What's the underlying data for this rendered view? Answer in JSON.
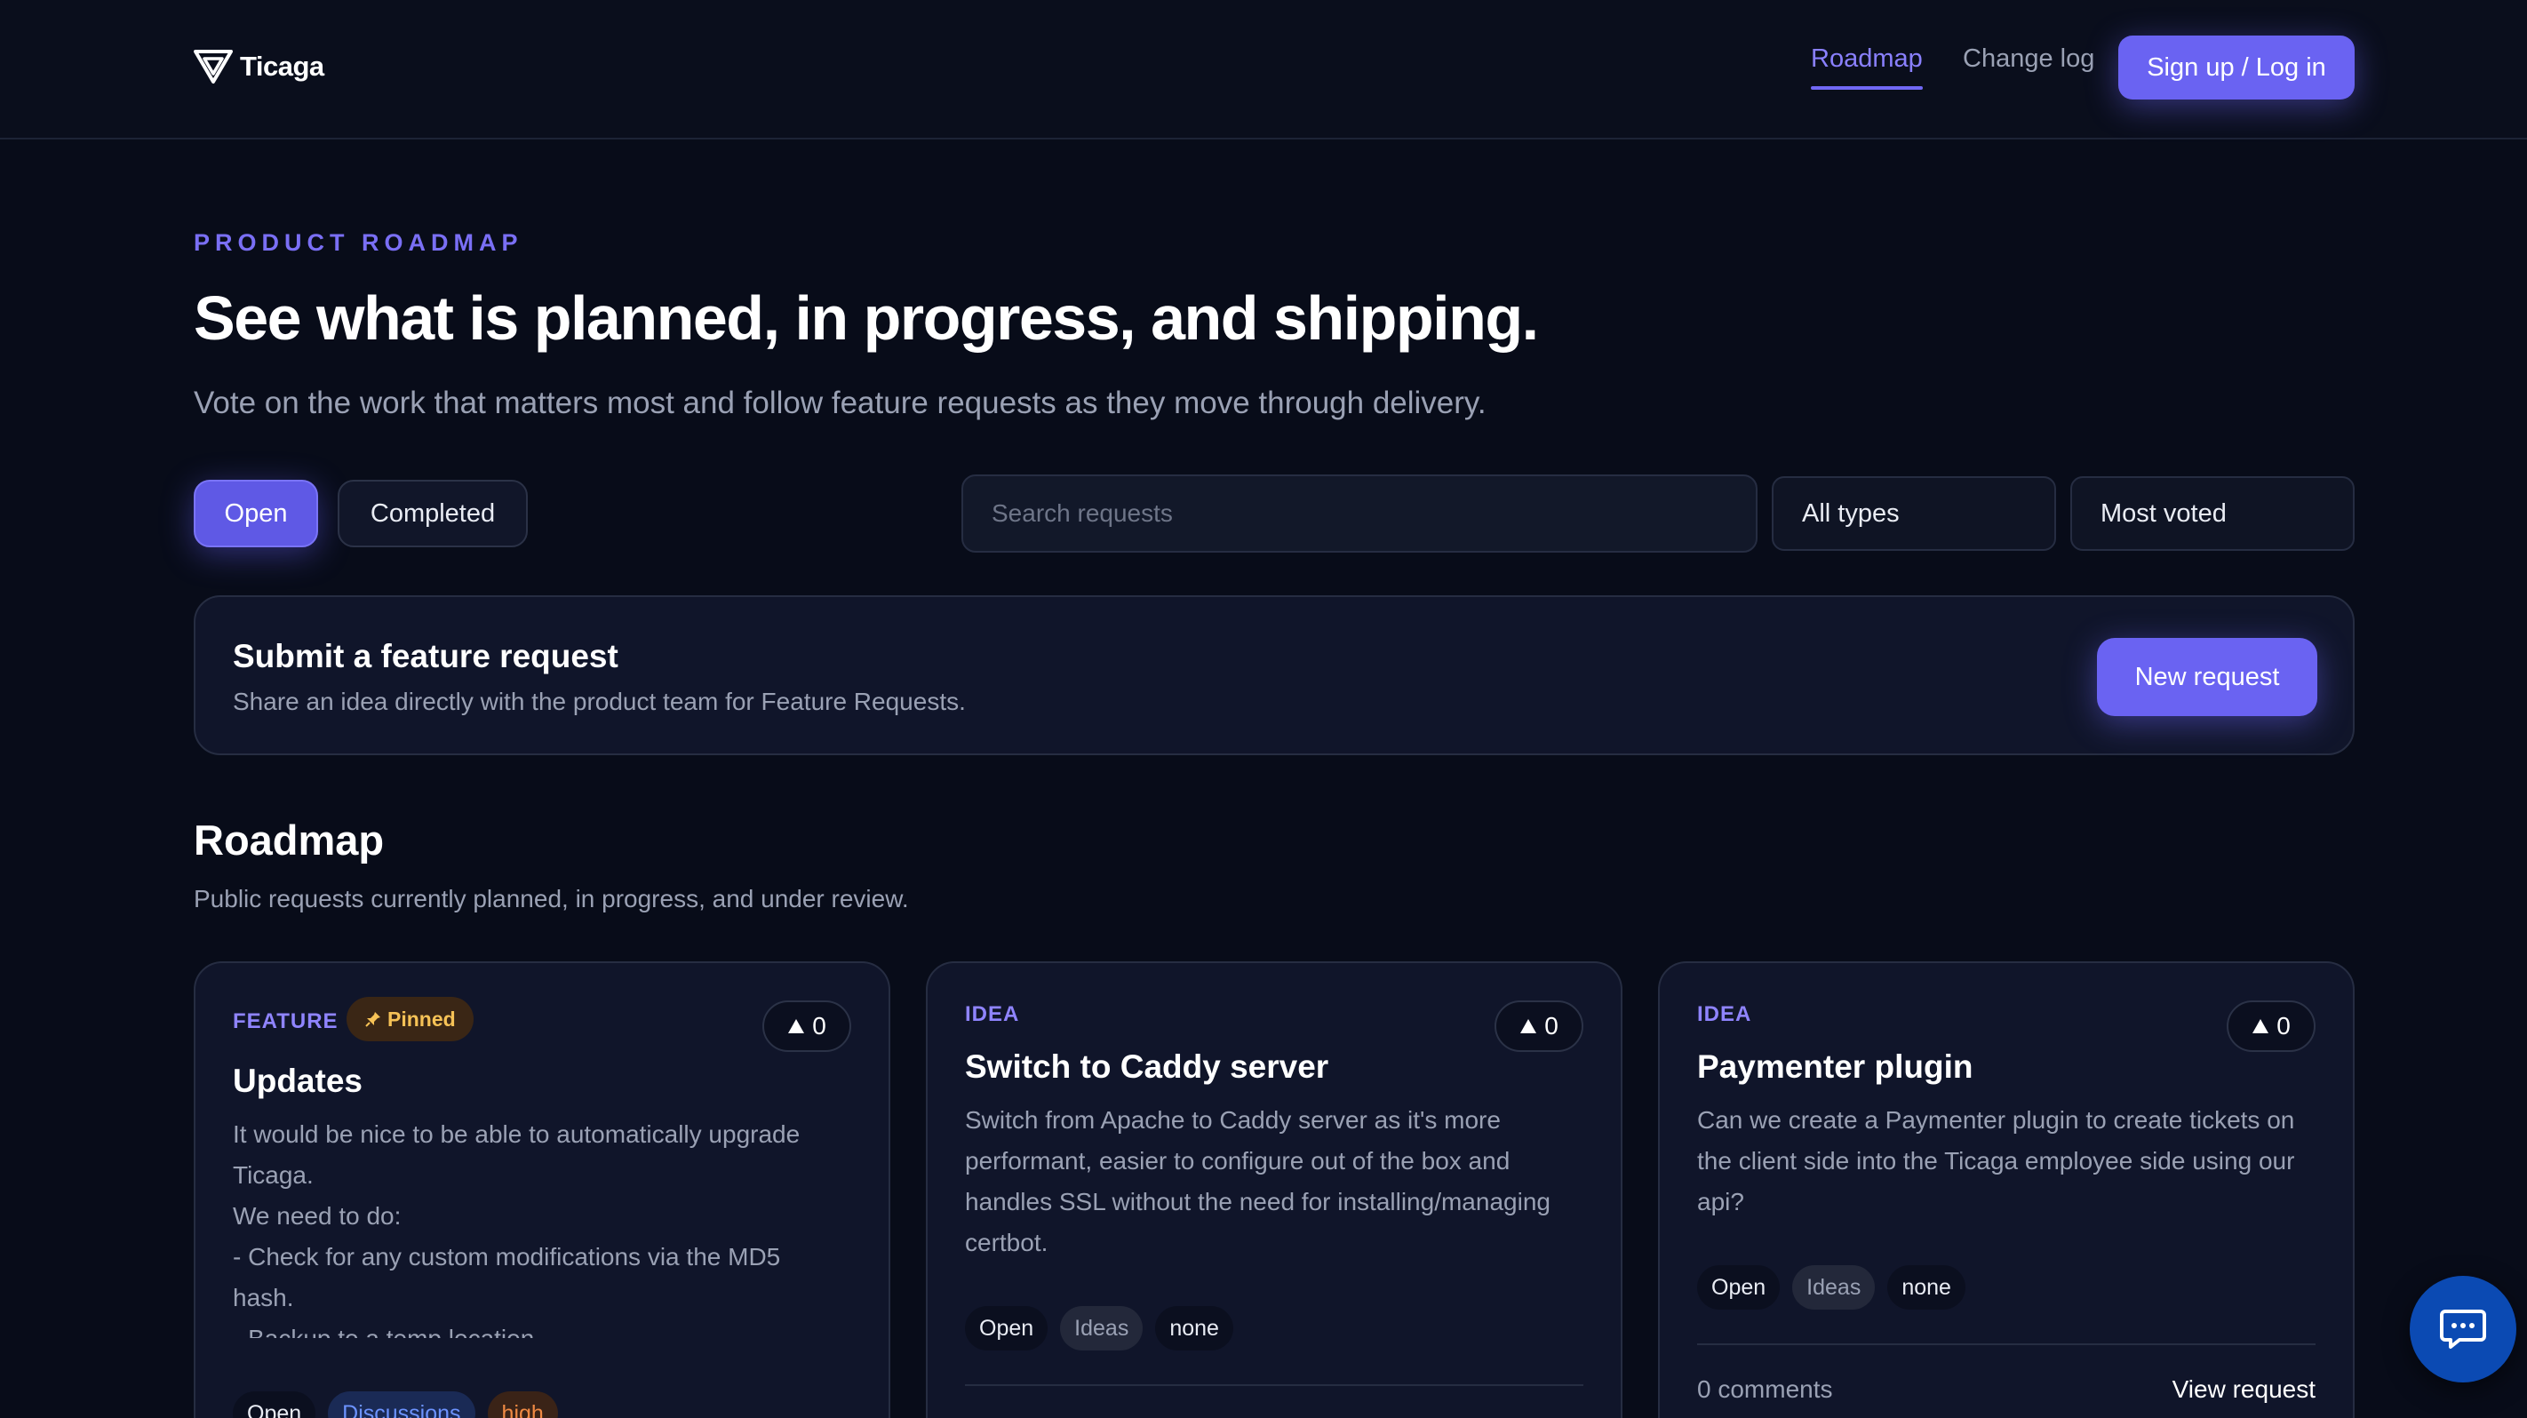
{
  "header": {
    "logo_text": "Ticaga",
    "nav": [
      {
        "label": "Roadmap",
        "active": true
      },
      {
        "label": "Change log",
        "active": false
      }
    ],
    "signup_label": "Sign up / Log in"
  },
  "hero": {
    "eyebrow": "PRODUCT ROADMAP",
    "title": "See what is planned, in progress, and shipping.",
    "subtitle": "Vote on the work that matters most and follow feature requests as they move through delivery."
  },
  "filters": {
    "tabs": [
      {
        "label": "Open",
        "active": true
      },
      {
        "label": "Completed",
        "active": false
      }
    ],
    "search_placeholder": "Search requests",
    "type_select": "All types",
    "sort_select": "Most voted"
  },
  "submit": {
    "title": "Submit a feature request",
    "subtitle": "Share an idea directly with the product team for Feature Requests.",
    "button_label": "New request"
  },
  "roadmap": {
    "title": "Roadmap",
    "subtitle": "Public requests currently planned, in progress, and under review.",
    "cards": [
      {
        "type": "FEATURE",
        "pinned_label": "Pinned",
        "votes": "0",
        "title": "Updates",
        "description_lines": [
          "It would be nice to be able to automatically upgrade",
          "Ticaga.",
          "We need to do:",
          "- Check for any custom modifications via the MD5",
          "hash.",
          "- Backup to a temp location"
        ],
        "chips": [
          "Open",
          "Discussions",
          "high"
        ]
      },
      {
        "type": "IDEA",
        "votes": "0",
        "title": "Switch to Caddy server",
        "description": "Switch from Apache to Caddy server as it's more performant, easier to configure out of the box and handles SSL without the need for installing/managing certbot.",
        "chips": [
          "Open",
          "Ideas",
          "none"
        ]
      },
      {
        "type": "IDEA",
        "votes": "0",
        "title": "Paymenter plugin",
        "description": "Can we create a Paymenter plugin to create tickets on the client side into the Ticaga employee side using our api?",
        "chips": [
          "Open",
          "Ideas",
          "none"
        ],
        "comments": "0 comments",
        "view_label": "View request"
      }
    ]
  },
  "colors": {
    "background": "#080c19",
    "accent": "#6a63f2",
    "eyebrow": "#7a6ff5",
    "pinned": "#f6c256",
    "chat_button": "#0b4ab3"
  },
  "icons": {
    "logo": "ticaga-logo-icon",
    "pinned": "pin-icon",
    "vote": "upvote-arrow-icon",
    "chat": "chat-bubble-icon"
  }
}
